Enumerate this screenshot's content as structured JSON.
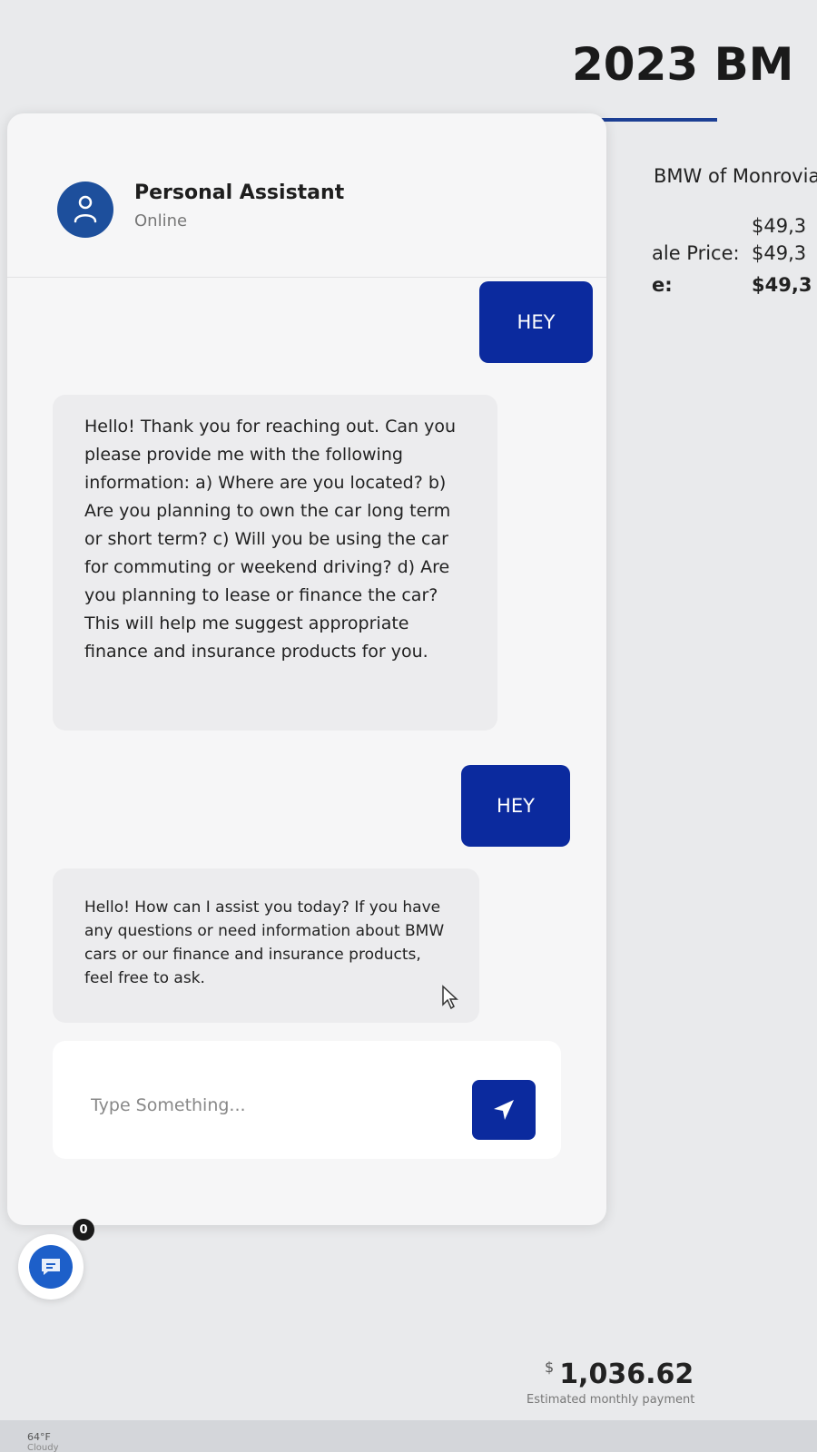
{
  "listing": {
    "title": "2023 BM",
    "dealer": "BMW of Monrovia",
    "prices": [
      {
        "label": "",
        "value": "$49,3"
      },
      {
        "label": "ale Price:",
        "value": "$49,3"
      },
      {
        "label": "e:",
        "value": "$49,3"
      }
    ],
    "payment": {
      "currency": "$",
      "amount": "1,036.62",
      "caption": "Estimated monthly payment"
    }
  },
  "chat": {
    "header": {
      "name": "Personal Assistant",
      "status": "Online"
    },
    "messages": [
      {
        "from": "user",
        "text": "HEY"
      },
      {
        "from": "bot",
        "text": "Hello! Thank you for reaching out. Can you please provide me with the following information: a) Where are you located? b) Are you planning to own the car long term or short term? c) Will you be using the car for commuting or weekend driving? d) Are you planning to lease or finance the car? This will help me suggest appropriate finance and insurance products for you."
      },
      {
        "from": "user",
        "text": "HEY"
      },
      {
        "from": "bot",
        "text": "Hello! How can I assist you today? If you have any questions or need information about BMW cars or our finance and insurance products, feel free to ask."
      }
    ],
    "input": {
      "placeholder": "Type Something...",
      "value": ""
    },
    "launcher_badge": "0"
  },
  "taskbar": {
    "temperature": "64°F",
    "condition": "Cloudy"
  },
  "colors": {
    "accent": "#0b2a9e",
    "avatar": "#1d4f9c",
    "bot_bubble": "#ececee"
  },
  "icons": {
    "avatar": "user-icon",
    "send": "send-arrow-icon",
    "launcher": "chat-icon"
  }
}
